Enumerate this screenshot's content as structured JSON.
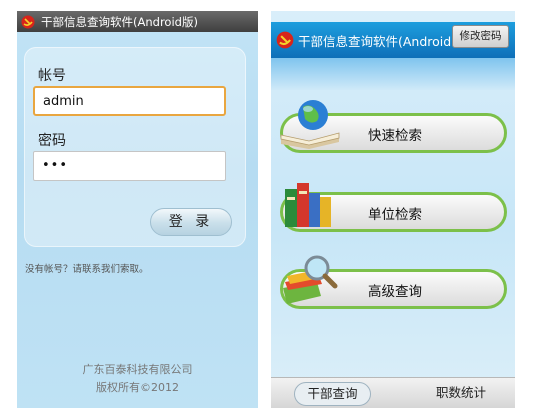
{
  "login_screen": {
    "title": "干部信息查询软件(Android版)",
    "username_label": "帐号",
    "username_value": "admin",
    "password_label": "密码",
    "password_value": "•••",
    "login_button": "登 录",
    "hint": "没有帐号？请联系我们索取。",
    "company": "广东百泰科技有限公司",
    "copyright": "版权所有©2012"
  },
  "main_screen": {
    "title": "干部信息查询软件(Android",
    "change_password_button": "修改密码",
    "menu": [
      {
        "label": "快速检索",
        "icon": "globe-book-icon"
      },
      {
        "label": "单位检索",
        "icon": "books-icon"
      },
      {
        "label": "高级查询",
        "icon": "magnifier-books-icon"
      }
    ],
    "tabs": [
      {
        "label": "干部查询",
        "active": true
      },
      {
        "label": "职数统计",
        "active": false
      }
    ]
  }
}
